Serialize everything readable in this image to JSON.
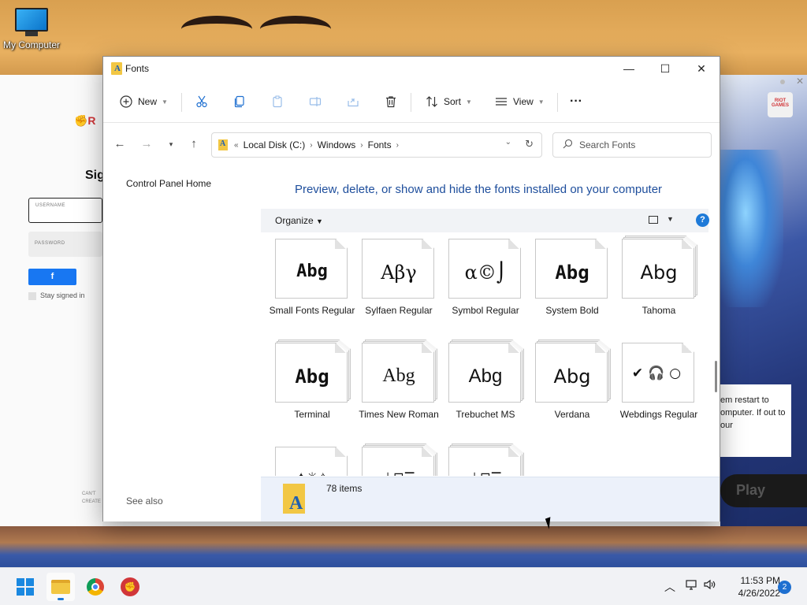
{
  "desktop": {
    "icon_label": "My Computer"
  },
  "background_app": {
    "signin_title": "Sig",
    "username_label": "USERNAME",
    "password_label": "PASSWORD",
    "stay_signed_in": "Stay signed in",
    "cant_create_1": "CAN'T",
    "cant_create_2": "CREATE",
    "riot_games_tag": "RIOT GAMES",
    "notice_text": "em restart to omputer. If out to our",
    "play_label": "Play"
  },
  "window": {
    "title": "Fonts",
    "controls": {
      "minimize": "—",
      "maximize": "☐",
      "close": "✕"
    }
  },
  "toolbar": {
    "new_label": "New",
    "sort_label": "Sort",
    "view_label": "View",
    "more_label": "···"
  },
  "address": {
    "overflow": "«",
    "crumbs": [
      "Local Disk (C:)",
      "Windows",
      "Fonts"
    ],
    "search_placeholder": "Search Fonts"
  },
  "left_pane": {
    "control_panel_home": "Control Panel Home",
    "see_also": "See also"
  },
  "main": {
    "heading": "Preview, delete, or show and hide the fonts installed on your computer",
    "organize_label": "Organize",
    "help_label": "?"
  },
  "fonts": [
    {
      "sample": "Abg",
      "label": "Small Fonts Regular",
      "stacked": false
    },
    {
      "sample": "Αβγ",
      "label": "Sylfaen Regular",
      "stacked": false
    },
    {
      "sample": "α©⌡",
      "label": "Symbol Regular",
      "stacked": false
    },
    {
      "sample": "Abg",
      "label": "System Bold",
      "stacked": false
    },
    {
      "sample": "Abg",
      "label": "Tahoma",
      "stacked": true
    },
    {
      "sample": "Abg",
      "label": "Terminal",
      "stacked": true
    },
    {
      "sample": "Abg",
      "label": "Times New Roman",
      "stacked": true
    },
    {
      "sample": "Abg",
      "label": "Trebuchet MS",
      "stacked": true
    },
    {
      "sample": "Abg",
      "label": "Verdana",
      "stacked": true
    },
    {
      "sample": "✔🎧○",
      "label": "Webdings Regular",
      "stacked": false
    },
    {
      "sample": "✦☼✧",
      "label": "",
      "stacked": false
    },
    {
      "sample": "⊥⊟☰",
      "label": "",
      "stacked": true
    },
    {
      "sample": "⊥⊟☰",
      "label": "",
      "stacked": true
    }
  ],
  "status": {
    "count": "78 items"
  },
  "taskbar": {
    "time": "11:53 PM",
    "date": "4/26/2022",
    "notifications": "2"
  }
}
